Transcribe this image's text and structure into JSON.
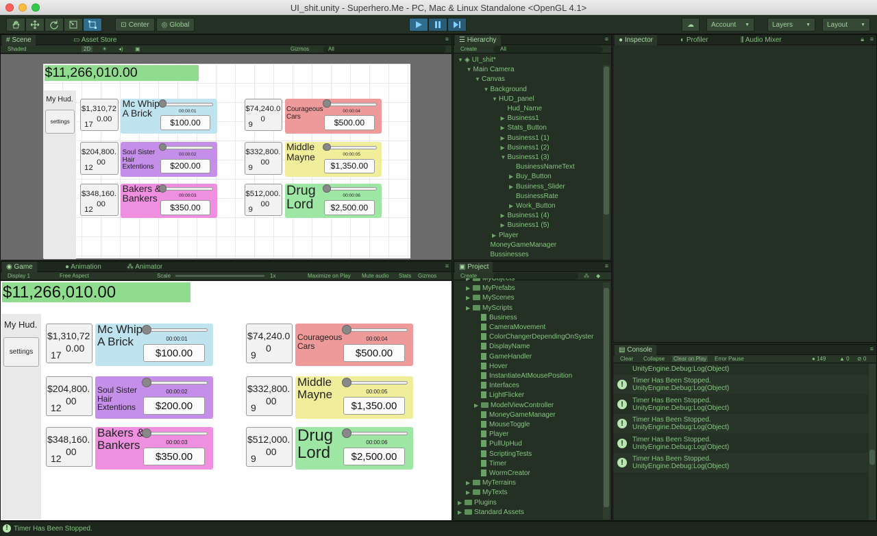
{
  "window": {
    "title": "UI_shit.unity - Superhero.Me - PC, Mac & Linux Standalone <OpenGL 4.1>"
  },
  "toolbar": {
    "center_label": "Center",
    "global_label": "Global",
    "account_label": "Account",
    "layers_label": "Layers",
    "layout_label": "Layout"
  },
  "scene_panel": {
    "tab_scene": "Scene",
    "tab_asset_store": "Asset Store",
    "shaded": "Shaded",
    "mode_2d": "2D",
    "gizmos": "Gizmos",
    "search_placeholder": "All"
  },
  "game_panel": {
    "tab_game": "Game",
    "tab_animation": "Animation",
    "tab_animator": "Animator",
    "display": "Display 1",
    "aspect": "Free Aspect",
    "scale_label": "Scale",
    "scale_value": "1x",
    "maximize": "Maximize on Play",
    "mute": "Mute audio",
    "stats": "Stats",
    "gizmos": "Gizmos"
  },
  "hud": {
    "money": "$11,266,010.00",
    "title": "My Hud.",
    "settings": "settings",
    "businesses": [
      {
        "stat_a": "$1,310,72",
        "stat_b": "0.00",
        "stat_c": "17",
        "name": "Mc Whip A Brick",
        "timer": "00:00:01",
        "price": "$100.00",
        "color": "#bfe3ef",
        "size": "big"
      },
      {
        "stat_a": "$204,800.",
        "stat_b": "00",
        "stat_c": "12",
        "name": "Soul Sister Hair Extentions",
        "timer": "00:00:02",
        "price": "$200.00",
        "color": "#c48ee9",
        "size": "small"
      },
      {
        "stat_a": "$348,160.",
        "stat_b": "00",
        "stat_c": "12",
        "name": "Bakers & Bankers",
        "timer": "00:00:03",
        "price": "$350.00",
        "color": "#ee8fe0",
        "size": "big"
      },
      {
        "stat_a": "$74,240.0",
        "stat_b": "0",
        "stat_c": "9",
        "name": "Courageous Cars",
        "timer": "00:00:04",
        "price": "$500.00",
        "color": "#ee9a9a",
        "size": "small"
      },
      {
        "stat_a": "$332,800.",
        "stat_b": "00",
        "stat_c": "9",
        "name": "Middle Mayne",
        "timer": "00:00:05",
        "price": "$1,350.00",
        "color": "#f0ee9a",
        "size": "big"
      },
      {
        "stat_a": "$512,000.",
        "stat_b": "00",
        "stat_c": "9",
        "name": "Drug Lord",
        "timer": "00:00:06",
        "price": "$2,500.00",
        "color": "#9ee6a4",
        "size": "huge"
      }
    ]
  },
  "hierarchy": {
    "tab": "Hierarchy",
    "create": "Create",
    "search_placeholder": "All",
    "rows": [
      {
        "label": "UI_shit*",
        "depth": 0,
        "arrow": "▼"
      },
      {
        "label": "Main Camera",
        "depth": 1,
        "arrow": "▼"
      },
      {
        "label": "Canvas",
        "depth": 2,
        "arrow": "▼"
      },
      {
        "label": "Background",
        "depth": 3,
        "arrow": "▼"
      },
      {
        "label": "HUD_panel",
        "depth": 4,
        "arrow": "▼"
      },
      {
        "label": "Hud_Name",
        "depth": 5,
        "arrow": ""
      },
      {
        "label": "Business1",
        "depth": 5,
        "arrow": "▶"
      },
      {
        "label": "Stats_Button",
        "depth": 5,
        "arrow": "▶"
      },
      {
        "label": "Business1 (1)",
        "depth": 5,
        "arrow": "▶"
      },
      {
        "label": "Business1 (2)",
        "depth": 5,
        "arrow": "▶"
      },
      {
        "label": "Business1 (3)",
        "depth": 5,
        "arrow": "▼"
      },
      {
        "label": "BusinessNameText",
        "depth": 6,
        "arrow": ""
      },
      {
        "label": "Buy_Button",
        "depth": 6,
        "arrow": "▶"
      },
      {
        "label": "Business_Slider",
        "depth": 6,
        "arrow": "▶"
      },
      {
        "label": "BusinessRate",
        "depth": 6,
        "arrow": ""
      },
      {
        "label": "Work_Button",
        "depth": 6,
        "arrow": "▶"
      },
      {
        "label": "Business1 (4)",
        "depth": 5,
        "arrow": "▶"
      },
      {
        "label": "Business1 (5)",
        "depth": 5,
        "arrow": "▶"
      },
      {
        "label": "Player",
        "depth": 4,
        "arrow": "▶"
      },
      {
        "label": "MoneyGameManager",
        "depth": 3,
        "arrow": ""
      },
      {
        "label": "Bussinesses",
        "depth": 3,
        "arrow": ""
      }
    ]
  },
  "inspector": {
    "tab_inspector": "Inspector",
    "tab_profiler": "Profiler",
    "tab_audio": "Audio Mixer"
  },
  "project": {
    "tab": "Project",
    "create": "Create",
    "rows": [
      {
        "label": "MyObjects",
        "depth": 1,
        "kind": "folder"
      },
      {
        "label": "MyPrefabs",
        "depth": 1,
        "kind": "folder"
      },
      {
        "label": "MyScenes",
        "depth": 1,
        "kind": "folder"
      },
      {
        "label": "MyScripts",
        "depth": 1,
        "kind": "folder"
      },
      {
        "label": "Business",
        "depth": 2,
        "kind": "script"
      },
      {
        "label": "CameraMovement",
        "depth": 2,
        "kind": "script"
      },
      {
        "label": "ColorChangerDependingOnSyster",
        "depth": 2,
        "kind": "script"
      },
      {
        "label": "DisplayName",
        "depth": 2,
        "kind": "script"
      },
      {
        "label": "GameHandler",
        "depth": 2,
        "kind": "script"
      },
      {
        "label": "Hover",
        "depth": 2,
        "kind": "script"
      },
      {
        "label": "InstantiateAtMousePosition",
        "depth": 2,
        "kind": "script"
      },
      {
        "label": "Interfaces",
        "depth": 2,
        "kind": "script"
      },
      {
        "label": "LightFlicker",
        "depth": 2,
        "kind": "script"
      },
      {
        "label": "ModelViewController",
        "depth": 2,
        "kind": "folder"
      },
      {
        "label": "MoneyGameManager",
        "depth": 2,
        "kind": "script"
      },
      {
        "label": "MouseToggle",
        "depth": 2,
        "kind": "script"
      },
      {
        "label": "Player",
        "depth": 2,
        "kind": "script"
      },
      {
        "label": "PullUpHud",
        "depth": 2,
        "kind": "script"
      },
      {
        "label": "ScriptingTests",
        "depth": 2,
        "kind": "script"
      },
      {
        "label": "Timer",
        "depth": 2,
        "kind": "script"
      },
      {
        "label": "WormCreator",
        "depth": 2,
        "kind": "script"
      },
      {
        "label": "MyTerrains",
        "depth": 1,
        "kind": "folder"
      },
      {
        "label": "MyTexts",
        "depth": 1,
        "kind": "folder"
      },
      {
        "label": "Plugins",
        "depth": 0,
        "kind": "folder"
      },
      {
        "label": "Standard Assets",
        "depth": 0,
        "kind": "folder"
      }
    ]
  },
  "console": {
    "tab": "Console",
    "clear": "Clear",
    "collapse": "Collapse",
    "clear_on_play": "Clear on Play",
    "error_pause": "Error Pause",
    "info_count": "149",
    "warn_count": "0",
    "error_count": "0",
    "top_partial": "UnityEngine.Debug:Log(Object)",
    "messages": [
      {
        "line1": "Timer Has Been Stopped.",
        "line2": "UnityEngine.Debug:Log(Object)"
      },
      {
        "line1": "Timer Has Been Stopped.",
        "line2": "UnityEngine.Debug:Log(Object)"
      },
      {
        "line1": "Timer Has Been Stopped.",
        "line2": "UnityEngine.Debug:Log(Object)"
      },
      {
        "line1": "Timer Has Been Stopped.",
        "line2": "UnityEngine.Debug:Log(Object)"
      },
      {
        "line1": "Timer Has Been Stopped.",
        "line2": "UnityEngine.Debug:Log(Object)"
      }
    ]
  },
  "status": {
    "message": "Timer Has Been Stopped."
  }
}
